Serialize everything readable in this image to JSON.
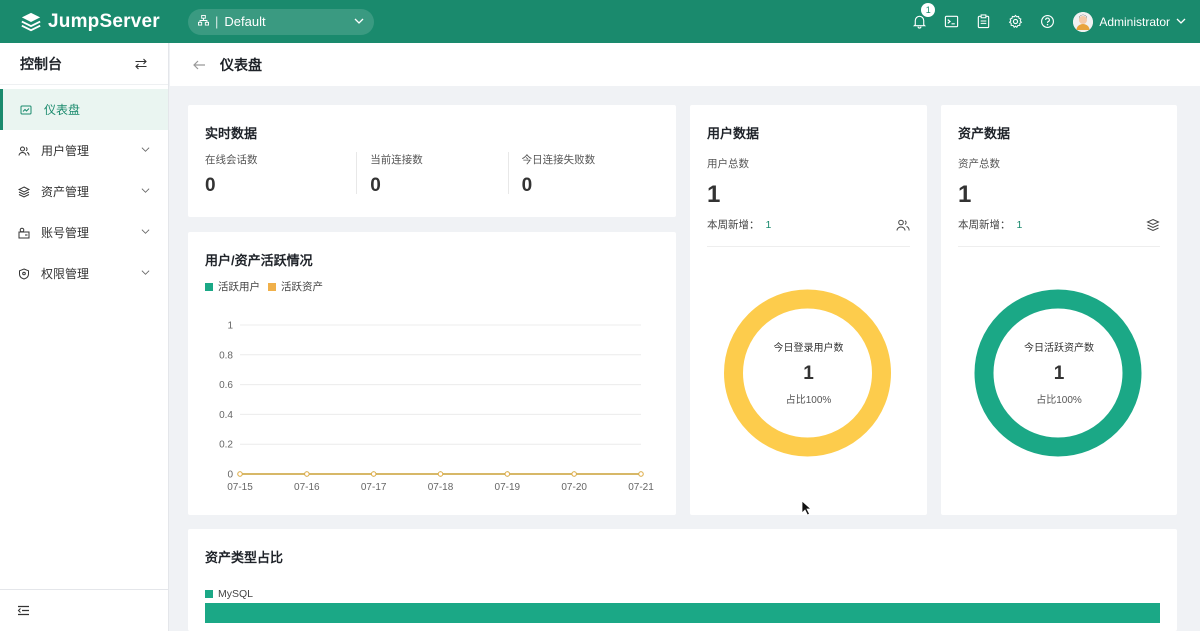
{
  "brand": {
    "name": "JumpServer"
  },
  "header": {
    "org": "Default",
    "notification_count": "1",
    "user": "Administrator",
    "icons": [
      "bell-icon",
      "terminal-icon",
      "clipboard-icon",
      "gear-icon",
      "help-icon"
    ]
  },
  "sidebar": {
    "title": "控制台",
    "items": [
      {
        "label": "仪表盘",
        "icon": "dashboard-icon",
        "active": true
      },
      {
        "label": "用户管理",
        "icon": "users-icon"
      },
      {
        "label": "资产管理",
        "icon": "layers-icon"
      },
      {
        "label": "账号管理",
        "icon": "account-icon"
      },
      {
        "label": "权限管理",
        "icon": "shield-icon"
      }
    ]
  },
  "page": {
    "title": "仪表盘"
  },
  "realtime": {
    "title": "实时数据",
    "stats": [
      {
        "label": "在线会话数",
        "value": "0"
      },
      {
        "label": "当前连接数",
        "value": "0"
      },
      {
        "label": "今日连接失败数",
        "value": "0"
      }
    ]
  },
  "activity": {
    "title": "用户/资产活跃情况",
    "legend": [
      "活跃用户",
      "活跃资产"
    ]
  },
  "users": {
    "title": "用户数据",
    "total_label": "用户总数",
    "total": "1",
    "week_label": "本周新增：",
    "week_value": "1",
    "donut_label": "今日登录用户数",
    "donut_value": "1",
    "donut_pct": "占比100%"
  },
  "assets": {
    "title": "资产数据",
    "total_label": "资产总数",
    "total": "1",
    "week_label": "本周新增：",
    "week_value": "1",
    "donut_label": "今日活跃资产数",
    "donut_value": "1",
    "donut_pct": "占比100%"
  },
  "asset_types": {
    "title": "资产类型占比",
    "legend": [
      "MySQL"
    ]
  },
  "colors": {
    "brand": "#1a8a6d",
    "active_users": "#1ba886",
    "active_assets": "#f0b04a",
    "user_donut": "#fdcc4c",
    "asset_donut": "#1ba886"
  },
  "chart_data": [
    {
      "type": "line",
      "categories": [
        "07-15",
        "07-16",
        "07-17",
        "07-18",
        "07-19",
        "07-20",
        "07-21"
      ],
      "series": [
        {
          "name": "活跃用户",
          "values": [
            0,
            0,
            0,
            0,
            0,
            0,
            0
          ]
        },
        {
          "name": "活跃资产",
          "values": [
            0,
            0,
            0,
            0,
            0,
            0,
            0
          ]
        }
      ],
      "y_ticks": [
        "0",
        "0.2",
        "0.4",
        "0.6",
        "0.8",
        "1"
      ],
      "ylim": [
        0,
        1
      ],
      "grid": true,
      "legend": "top-left"
    },
    {
      "type": "pie",
      "labels": [
        "今日登录用户数"
      ],
      "values": [
        1
      ]
    },
    {
      "type": "pie",
      "labels": [
        "今日活跃资产数"
      ],
      "values": [
        1
      ]
    },
    {
      "type": "bar",
      "categories": [
        "MySQL"
      ],
      "values": [
        100
      ]
    }
  ]
}
